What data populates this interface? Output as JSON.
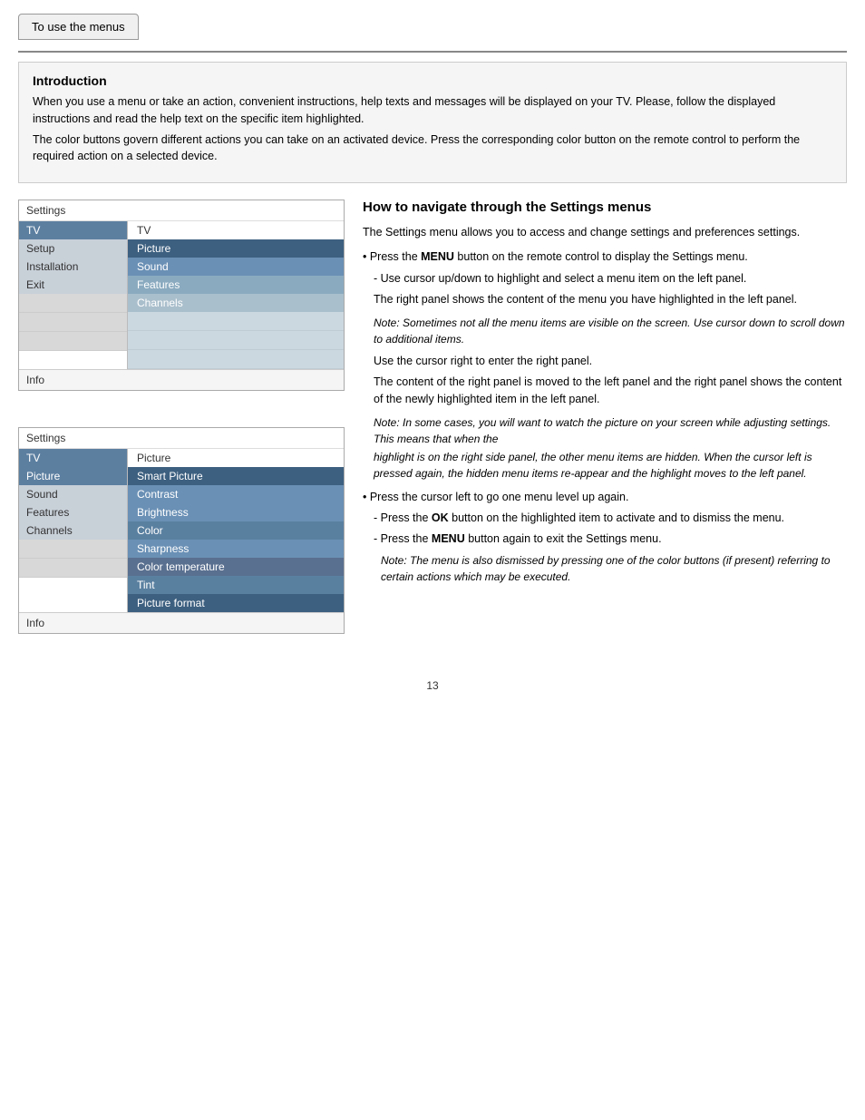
{
  "header": {
    "tab_label": "To use the menus"
  },
  "intro": {
    "title": "Introduction",
    "paragraph1": "When you use a menu or take an action, convenient instructions, help texts and messages will be displayed on your TV. Please, follow the displayed instructions and read the help text on the specific item highlighted.",
    "paragraph2": "The color buttons govern different actions you can take on an activated device. Press the corresponding color button on the remote control to perform the required action on a selected device."
  },
  "diagram1": {
    "settings_label": "Settings",
    "tv_label": "TV",
    "left_items": [
      "TV",
      "Setup",
      "Installation",
      "Exit",
      "",
      "",
      ""
    ],
    "right_header": "TV",
    "right_items": [
      "Picture",
      "Sound",
      "Features",
      "Channels",
      "",
      "",
      ""
    ],
    "info_label": "Info"
  },
  "diagram2": {
    "settings_label": "Settings",
    "tv_label": "TV",
    "left_items": [
      "TV",
      "Picture",
      "Sound",
      "Features",
      "Channels",
      "",
      ""
    ],
    "right_header": "Picture",
    "right_items": [
      "Smart Picture",
      "Contrast",
      "Brightness",
      "Color",
      "Sharpness",
      "Color temperature",
      "Tint",
      "Picture format"
    ],
    "info_label": "Info"
  },
  "howto": {
    "title": "How to navigate through the Settings menus",
    "intro": "The Settings menu allows you to access and change settings and preferences settings.",
    "bullets": [
      {
        "type": "bullet",
        "text": "Press the MENU button on the remote control to display the Settings menu."
      },
      {
        "type": "dash",
        "text": "Use cursor up/down to highlight and select a menu item on the left panel."
      }
    ],
    "indent1": "The right panel shows the content of the  menu you have highlighted in the left panel.",
    "note1": "Note: Sometimes not all the menu items are visible on the screen. Use cursor down to scroll down to additional items.",
    "dash2": "Use the cursor right to enter the right panel.",
    "indent2": "The content of the right panel is moved to the left panel and the right panel shows the content of the newly highlighted item in the left panel.",
    "note2": "Note: In some cases, you will want to watch the picture on your screen while adjusting settings. This means that when the",
    "note3": "highlight is on the right side panel, the other menu items are hidden. When the cursor left is pressed again, the hidden menu items re-appear and the highlight moves to the left panel.",
    "bullet2": "Press the cursor left to go one menu level up again.",
    "dash3": "Press the OK button on the highlighted item to activate and to dismiss the menu.",
    "dash4": "Press the MENU button again to exit the Settings menu.",
    "note4": "Note: The menu is also dismissed by pressing one of the color buttons (if present) referring to certain actions which may be executed."
  },
  "page_number": "13"
}
